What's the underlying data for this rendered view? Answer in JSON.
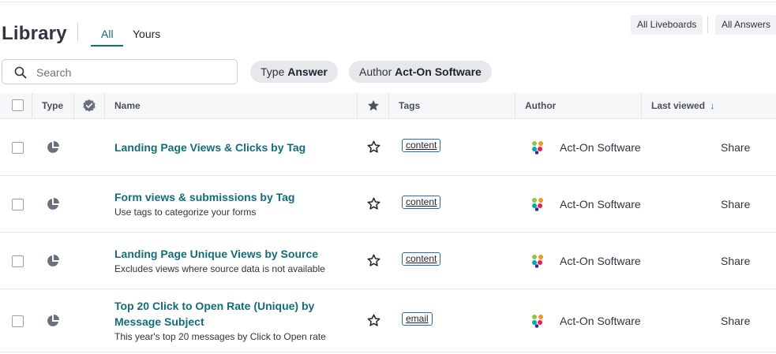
{
  "header": {
    "title": "Library",
    "tabs": [
      {
        "label": "All",
        "active": true
      },
      {
        "label": "Yours",
        "active": false
      }
    ],
    "buttons": {
      "liveboards": "All Liveboards",
      "answers": "All Answers"
    }
  },
  "search": {
    "placeholder": "Search",
    "value": ""
  },
  "filters": {
    "type": {
      "label": "Type",
      "value": "Answer"
    },
    "author": {
      "label": "Author",
      "value": "Act-On Software"
    }
  },
  "table": {
    "columns": {
      "type": "Type",
      "name": "Name",
      "tags": "Tags",
      "author": "Author",
      "last_viewed": "Last viewed",
      "sort_indicator": "↓"
    },
    "rows": [
      {
        "name": "Landing Page Views & Clicks by Tag",
        "description": "",
        "tag": "content",
        "author": "Act-On Software",
        "action": "Share"
      },
      {
        "name": "Form views & submissions by Tag",
        "description": "Use tags to categorize your forms",
        "tag": "content",
        "author": "Act-On Software",
        "action": "Share"
      },
      {
        "name": "Landing Page Unique Views by Source",
        "description": "Excludes views where source data is not available",
        "tag": "content",
        "author": "Act-On Software",
        "action": "Share"
      },
      {
        "name_line1": "Top 20 Click to Open Rate (Unique) by",
        "name_line2": "Message Subject",
        "description": "This year's top 20 messages by Click to Open rate",
        "tag": "email",
        "author": "Act-On Software",
        "action": "Share"
      }
    ]
  },
  "colors": {
    "accent": "#136d79",
    "tag_border": "#2b6aa8",
    "header_bg": "#f6f7f9",
    "chip_bg": "#e6e8ec"
  },
  "icons": {
    "search": "search-icon",
    "verified": "verified-badge-icon",
    "star": "star-icon",
    "pie": "pie-chart-icon",
    "author_logo": "act-on-logo-icon"
  }
}
